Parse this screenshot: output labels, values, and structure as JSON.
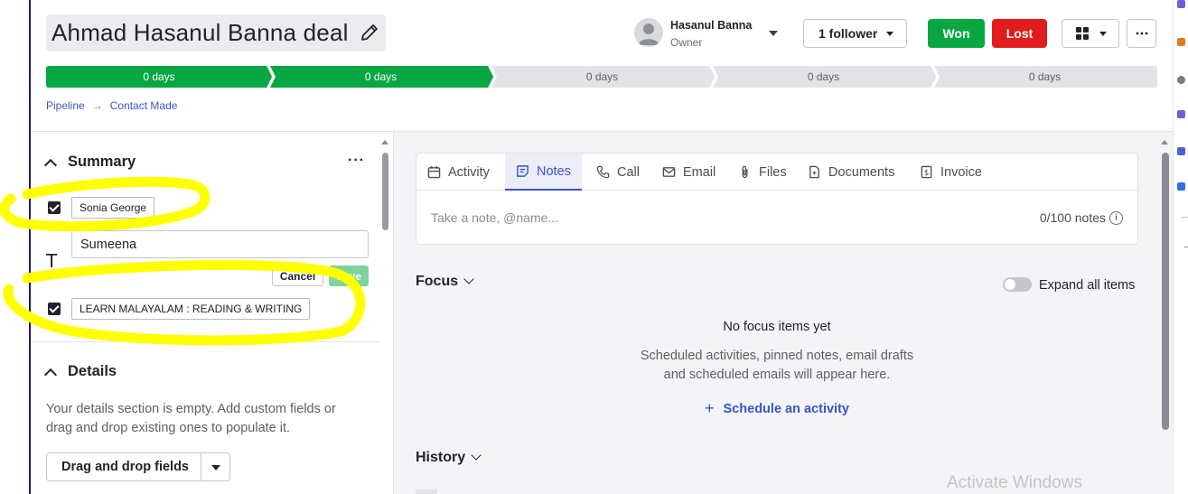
{
  "deal": {
    "title": "Ahmad Hasanul Banna deal",
    "owner_name": "Hasanul Banna",
    "owner_role": "Owner",
    "follower_label": "1 follower",
    "won_label": "Won",
    "lost_label": "Lost"
  },
  "pipeline": {
    "stages": [
      {
        "label": "0 days",
        "active": true
      },
      {
        "label": "0 days",
        "active": true
      },
      {
        "label": "0 days",
        "active": false
      },
      {
        "label": "0 days",
        "active": false
      },
      {
        "label": "0 days",
        "active": false
      }
    ],
    "breadcrumb": [
      "Pipeline",
      "Contact Made"
    ]
  },
  "summary": {
    "heading": "Summary",
    "more_label": "···",
    "tag1": "Sonia George",
    "input_value": "Sumeena",
    "cancel_label": "Cancel",
    "save_label": "Save",
    "tag2": "LEARN MALAYALAM : READING & WRITING"
  },
  "details": {
    "heading": "Details",
    "empty_text": "Your details section is empty. Add custom fields or drag and drop existing ones to populate it.",
    "drag_label": "Drag and drop fields"
  },
  "tabs": [
    {
      "label": "Activity",
      "icon": "calendar-icon"
    },
    {
      "label": "Notes",
      "icon": "notes-icon"
    },
    {
      "label": "Call",
      "icon": "phone-icon"
    },
    {
      "label": "Email",
      "icon": "email-icon"
    },
    {
      "label": "Files",
      "icon": "paperclip-icon"
    },
    {
      "label": "Documents",
      "icon": "document-icon"
    },
    {
      "label": "Invoice",
      "icon": "invoice-icon"
    }
  ],
  "notes": {
    "placeholder": "Take a note, @name...",
    "count": "0/100 notes"
  },
  "focus": {
    "heading": "Focus",
    "expand_label": "Expand all items",
    "empty_title": "No focus items yet",
    "empty_desc_line1": "Scheduled activities, pinned notes, email drafts",
    "empty_desc_line2": "and scheduled emails will appear here.",
    "schedule_label": "Schedule an activity"
  },
  "history": {
    "heading": "History"
  },
  "watermark": "Activate Windows",
  "colors": {
    "accent": "#3a55c4",
    "won": "#08a742",
    "lost": "#e21c1c",
    "stage_active": "#08a742",
    "stage_inactive": "#e2e3e6",
    "highlight": "#ffff00"
  }
}
